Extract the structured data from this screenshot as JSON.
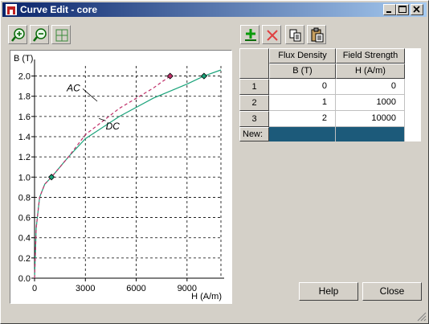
{
  "window": {
    "title": "Curve Edit - core"
  },
  "toolbar": {
    "left": [
      "zoom-in-icon",
      "zoom-out-icon",
      "zoom-fit-icon"
    ],
    "right": [
      "add-row-icon",
      "delete-row-icon",
      "copy-icon",
      "paste-icon"
    ]
  },
  "chart": {
    "ylabel": "B (T)",
    "xlabel": "H (A/m)",
    "label_ac": "AC",
    "label_dc": "DC"
  },
  "chart_data": {
    "type": "line",
    "xlabel": "H (A/m)",
    "ylabel": "B (T)",
    "xlim": [
      0,
      11000
    ],
    "ylim": [
      0,
      2.1
    ],
    "x_ticks": [
      "0",
      "3000",
      "6000",
      "9000"
    ],
    "y_ticks": [
      "0.0",
      "0.2",
      "0.4",
      "0.6",
      "0.8",
      "1.0",
      "1.2",
      "1.4",
      "1.6",
      "1.8",
      "2.0"
    ],
    "grid": true,
    "series": [
      {
        "name": "DC",
        "color": "#1aa37a",
        "style": "solid",
        "x": [
          0,
          100,
          300,
          600,
          1000,
          2000,
          3000,
          5000,
          7000,
          9000,
          10000,
          11000
        ],
        "y": [
          0,
          0.5,
          0.8,
          0.93,
          1.0,
          1.2,
          1.38,
          1.6,
          1.78,
          1.92,
          2.0,
          2.06
        ]
      },
      {
        "name": "AC",
        "color": "#c0306a",
        "style": "dashed",
        "x": [
          0,
          100,
          300,
          600,
          1000,
          2000,
          3000,
          5000,
          7000,
          8000
        ],
        "y": [
          0,
          0.5,
          0.8,
          0.93,
          1.0,
          1.2,
          1.42,
          1.68,
          1.88,
          2.0
        ]
      }
    ],
    "markers": [
      {
        "x": 1000,
        "y": 1.0,
        "color": "#1aa37a"
      },
      {
        "x": 10000,
        "y": 2.0,
        "color": "#1aa37a"
      },
      {
        "x": 8000,
        "y": 2.0,
        "color": "#c0306a"
      }
    ]
  },
  "table": {
    "columns": [
      {
        "name": "Flux Density",
        "unit": "B (T)"
      },
      {
        "name": "Field Strength",
        "unit": "H (A/m)"
      }
    ],
    "rows": [
      {
        "num": "1",
        "b": "0",
        "h": "0"
      },
      {
        "num": "2",
        "b": "1",
        "h": "1000"
      },
      {
        "num": "3",
        "b": "2",
        "h": "10000"
      }
    ],
    "new_label": "New:"
  },
  "buttons": {
    "help": "Help",
    "close": "Close"
  }
}
